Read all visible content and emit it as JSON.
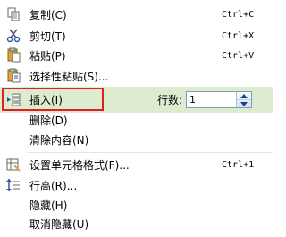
{
  "menu": {
    "items": [
      {
        "label": "复制(C)",
        "shortcut": "Ctrl+C",
        "icon": "copy-icon"
      },
      {
        "label": "剪切(T)",
        "shortcut": "Ctrl+X",
        "icon": "scissors-icon"
      },
      {
        "label": "粘贴(P)",
        "shortcut": "Ctrl+V",
        "icon": "paste-icon"
      },
      {
        "label": "选择性粘贴(S)...",
        "icon": "paste-special-icon"
      },
      {
        "label": "插入(I)",
        "icon": "insert-rows-icon"
      },
      {
        "label": "删除(D)"
      },
      {
        "label": "清除内容(N)"
      },
      {
        "label": "设置单元格格式(F)...",
        "shortcut": "Ctrl+1",
        "icon": "format-cells-icon"
      },
      {
        "label": "行高(R)...",
        "icon": "row-height-icon"
      },
      {
        "label": "隐藏(H)"
      },
      {
        "label": "取消隐藏(U)"
      }
    ],
    "insert_rows": {
      "label": "行数:",
      "value": "1"
    }
  },
  "colors": {
    "hover_background": "#ddeccf",
    "focus_border": "#e02020",
    "separator": "#e4e4e4",
    "spin_border": "#7f9db9"
  }
}
